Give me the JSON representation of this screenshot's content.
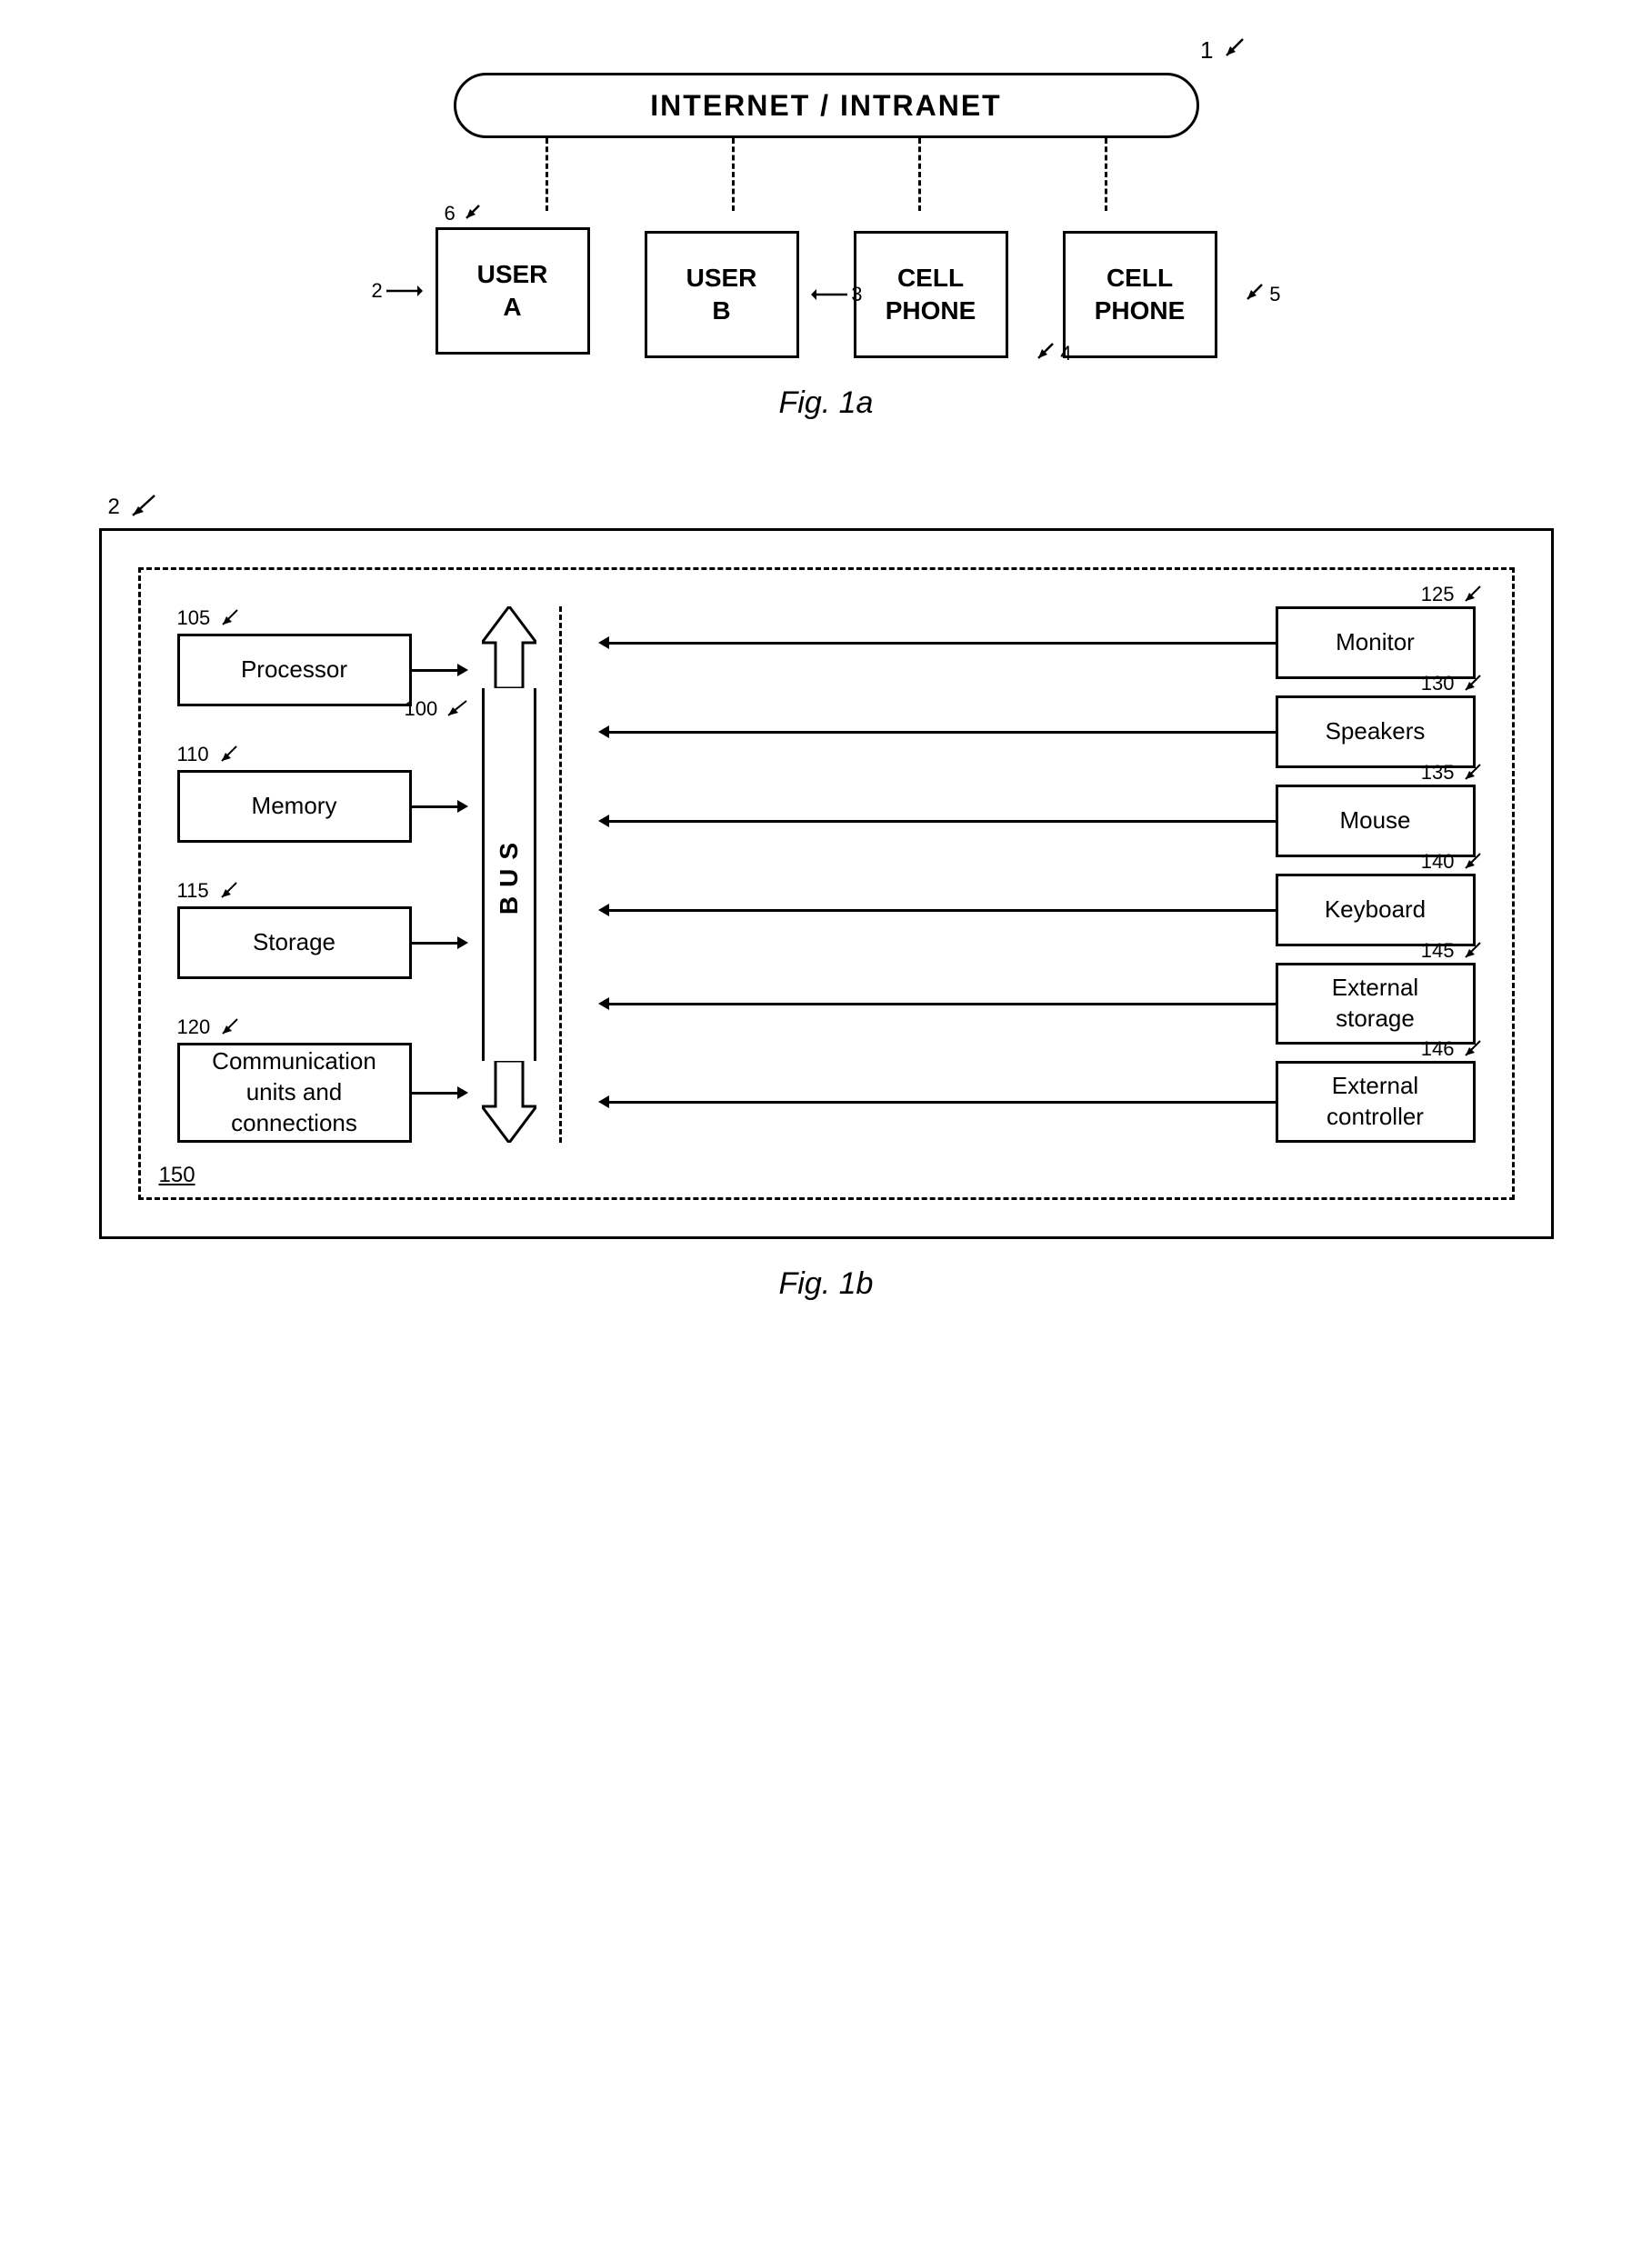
{
  "fig1a": {
    "caption": "Fig. 1a",
    "inet_label": "INTERNET / INTRANET",
    "ref_1": "1",
    "ref_2": "2",
    "ref_3": "3",
    "ref_4": "4",
    "ref_5": "5",
    "ref_6": "6",
    "devices": [
      {
        "id": "user-a",
        "label": "USER\nA",
        "num": "2",
        "num_pos": "top-left",
        "has_left_arrow": true,
        "left_arrow_num": "2"
      },
      {
        "id": "user-b",
        "label": "USER\nB",
        "num": "3",
        "num_pos": "top-right"
      },
      {
        "id": "cell-phone-1",
        "label": "CELL\nPHONE",
        "num": "4",
        "num_pos": "bottom-right"
      },
      {
        "id": "cell-phone-2",
        "label": "CELL\nPHONE",
        "num": "5",
        "num_pos": "right"
      }
    ]
  },
  "fig1b": {
    "caption": "Fig. 1b",
    "ref_2": "2",
    "ref_150": "150",
    "ref_100": "100",
    "bus_label": "B\nU\nS",
    "left_components": [
      {
        "num": "105",
        "label": "Processor"
      },
      {
        "num": "110",
        "label": "Memory"
      },
      {
        "num": "115",
        "label": "Storage"
      },
      {
        "num": "120",
        "label": "Communication\nunits and\nconnections"
      }
    ],
    "right_peripherals": [
      {
        "num": "125",
        "label": "Monitor"
      },
      {
        "num": "130",
        "label": "Speakers"
      },
      {
        "num": "135",
        "label": "Mouse"
      },
      {
        "num": "140",
        "label": "Keyboard"
      },
      {
        "num": "145",
        "label": "External\nstorage"
      },
      {
        "num": "146",
        "label": "External\ncontroller"
      }
    ]
  }
}
